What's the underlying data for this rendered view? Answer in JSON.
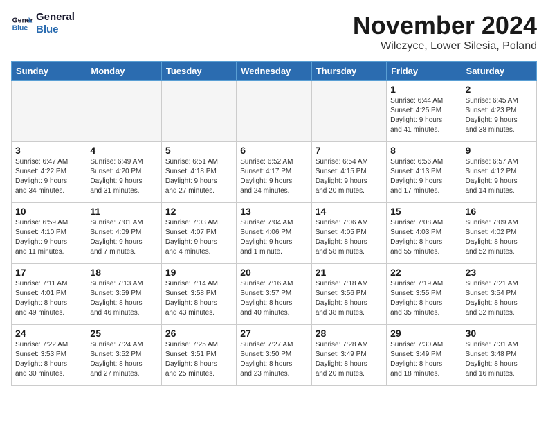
{
  "logo": {
    "line1": "General",
    "line2": "Blue"
  },
  "title": "November 2024",
  "subtitle": "Wilczyce, Lower Silesia, Poland",
  "headers": [
    "Sunday",
    "Monday",
    "Tuesday",
    "Wednesday",
    "Thursday",
    "Friday",
    "Saturday"
  ],
  "weeks": [
    [
      {
        "day": "",
        "info": ""
      },
      {
        "day": "",
        "info": ""
      },
      {
        "day": "",
        "info": ""
      },
      {
        "day": "",
        "info": ""
      },
      {
        "day": "",
        "info": ""
      },
      {
        "day": "1",
        "info": "Sunrise: 6:44 AM\nSunset: 4:25 PM\nDaylight: 9 hours\nand 41 minutes."
      },
      {
        "day": "2",
        "info": "Sunrise: 6:45 AM\nSunset: 4:23 PM\nDaylight: 9 hours\nand 38 minutes."
      }
    ],
    [
      {
        "day": "3",
        "info": "Sunrise: 6:47 AM\nSunset: 4:22 PM\nDaylight: 9 hours\nand 34 minutes."
      },
      {
        "day": "4",
        "info": "Sunrise: 6:49 AM\nSunset: 4:20 PM\nDaylight: 9 hours\nand 31 minutes."
      },
      {
        "day": "5",
        "info": "Sunrise: 6:51 AM\nSunset: 4:18 PM\nDaylight: 9 hours\nand 27 minutes."
      },
      {
        "day": "6",
        "info": "Sunrise: 6:52 AM\nSunset: 4:17 PM\nDaylight: 9 hours\nand 24 minutes."
      },
      {
        "day": "7",
        "info": "Sunrise: 6:54 AM\nSunset: 4:15 PM\nDaylight: 9 hours\nand 20 minutes."
      },
      {
        "day": "8",
        "info": "Sunrise: 6:56 AM\nSunset: 4:13 PM\nDaylight: 9 hours\nand 17 minutes."
      },
      {
        "day": "9",
        "info": "Sunrise: 6:57 AM\nSunset: 4:12 PM\nDaylight: 9 hours\nand 14 minutes."
      }
    ],
    [
      {
        "day": "10",
        "info": "Sunrise: 6:59 AM\nSunset: 4:10 PM\nDaylight: 9 hours\nand 11 minutes."
      },
      {
        "day": "11",
        "info": "Sunrise: 7:01 AM\nSunset: 4:09 PM\nDaylight: 9 hours\nand 7 minutes."
      },
      {
        "day": "12",
        "info": "Sunrise: 7:03 AM\nSunset: 4:07 PM\nDaylight: 9 hours\nand 4 minutes."
      },
      {
        "day": "13",
        "info": "Sunrise: 7:04 AM\nSunset: 4:06 PM\nDaylight: 9 hours\nand 1 minute."
      },
      {
        "day": "14",
        "info": "Sunrise: 7:06 AM\nSunset: 4:05 PM\nDaylight: 8 hours\nand 58 minutes."
      },
      {
        "day": "15",
        "info": "Sunrise: 7:08 AM\nSunset: 4:03 PM\nDaylight: 8 hours\nand 55 minutes."
      },
      {
        "day": "16",
        "info": "Sunrise: 7:09 AM\nSunset: 4:02 PM\nDaylight: 8 hours\nand 52 minutes."
      }
    ],
    [
      {
        "day": "17",
        "info": "Sunrise: 7:11 AM\nSunset: 4:01 PM\nDaylight: 8 hours\nand 49 minutes."
      },
      {
        "day": "18",
        "info": "Sunrise: 7:13 AM\nSunset: 3:59 PM\nDaylight: 8 hours\nand 46 minutes."
      },
      {
        "day": "19",
        "info": "Sunrise: 7:14 AM\nSunset: 3:58 PM\nDaylight: 8 hours\nand 43 minutes."
      },
      {
        "day": "20",
        "info": "Sunrise: 7:16 AM\nSunset: 3:57 PM\nDaylight: 8 hours\nand 40 minutes."
      },
      {
        "day": "21",
        "info": "Sunrise: 7:18 AM\nSunset: 3:56 PM\nDaylight: 8 hours\nand 38 minutes."
      },
      {
        "day": "22",
        "info": "Sunrise: 7:19 AM\nSunset: 3:55 PM\nDaylight: 8 hours\nand 35 minutes."
      },
      {
        "day": "23",
        "info": "Sunrise: 7:21 AM\nSunset: 3:54 PM\nDaylight: 8 hours\nand 32 minutes."
      }
    ],
    [
      {
        "day": "24",
        "info": "Sunrise: 7:22 AM\nSunset: 3:53 PM\nDaylight: 8 hours\nand 30 minutes."
      },
      {
        "day": "25",
        "info": "Sunrise: 7:24 AM\nSunset: 3:52 PM\nDaylight: 8 hours\nand 27 minutes."
      },
      {
        "day": "26",
        "info": "Sunrise: 7:25 AM\nSunset: 3:51 PM\nDaylight: 8 hours\nand 25 minutes."
      },
      {
        "day": "27",
        "info": "Sunrise: 7:27 AM\nSunset: 3:50 PM\nDaylight: 8 hours\nand 23 minutes."
      },
      {
        "day": "28",
        "info": "Sunrise: 7:28 AM\nSunset: 3:49 PM\nDaylight: 8 hours\nand 20 minutes."
      },
      {
        "day": "29",
        "info": "Sunrise: 7:30 AM\nSunset: 3:49 PM\nDaylight: 8 hours\nand 18 minutes."
      },
      {
        "day": "30",
        "info": "Sunrise: 7:31 AM\nSunset: 3:48 PM\nDaylight: 8 hours\nand 16 minutes."
      }
    ]
  ]
}
